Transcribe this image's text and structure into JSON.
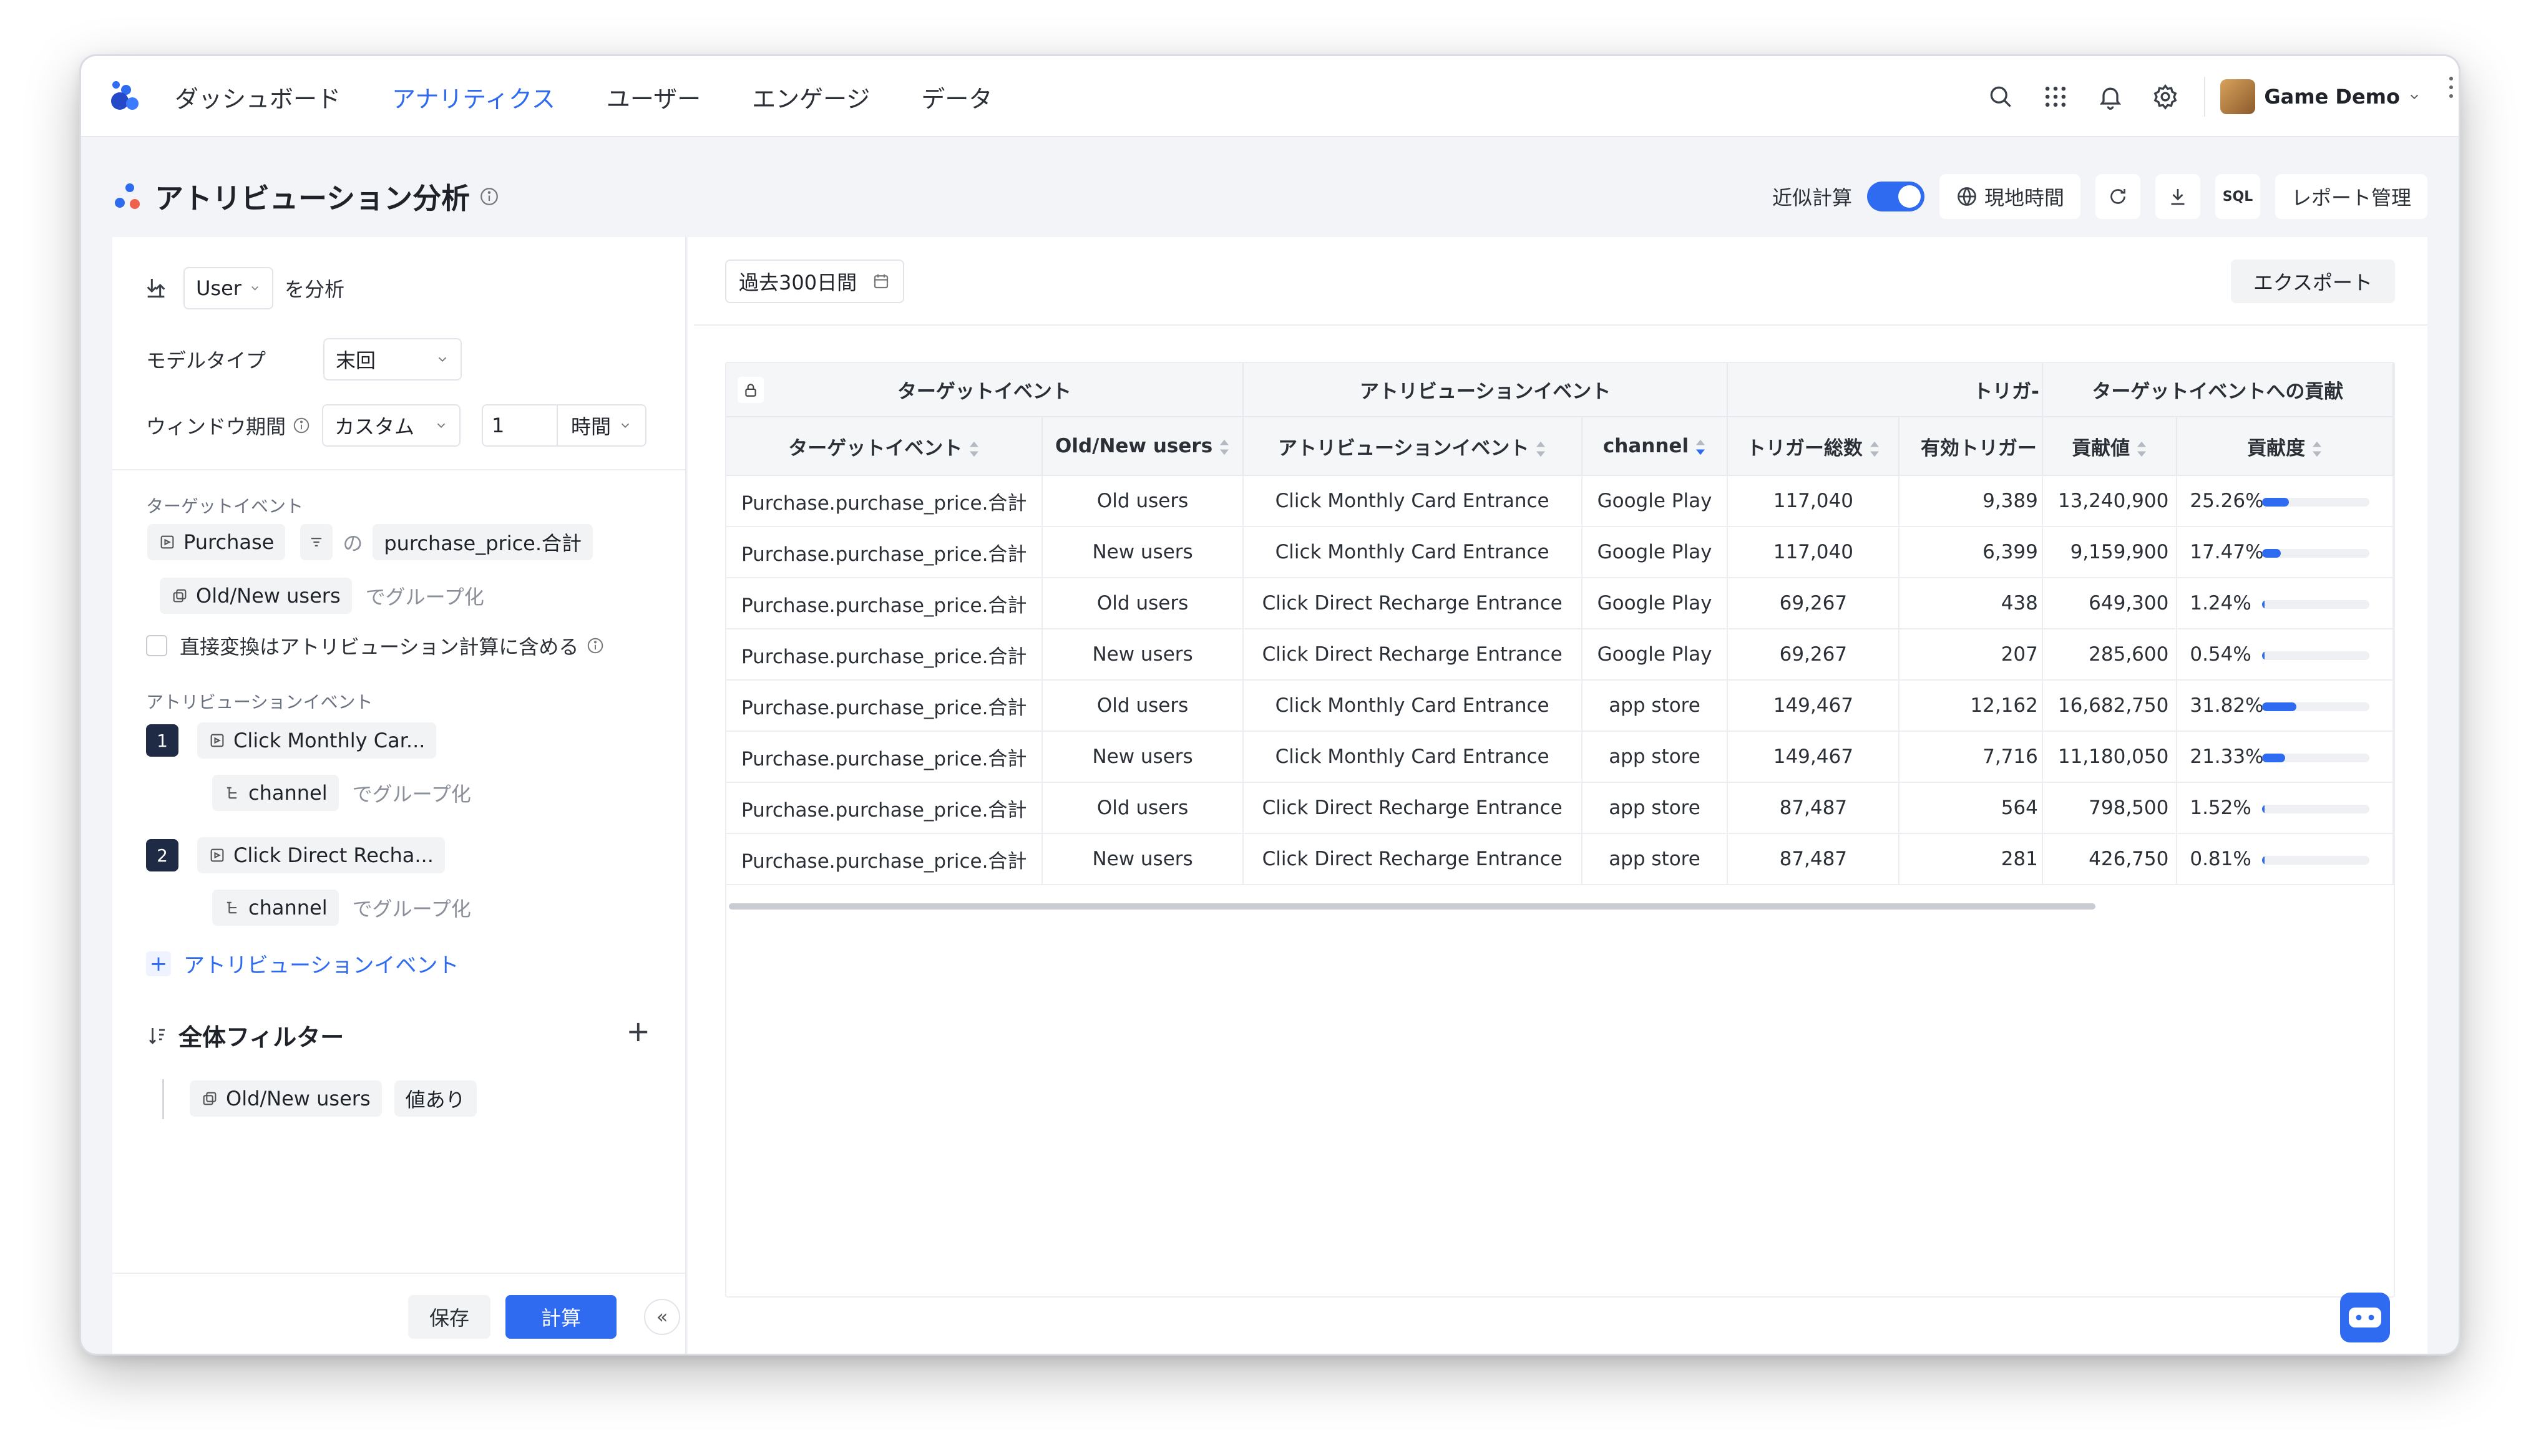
{
  "nav": {
    "items": [
      "ダッシュボード",
      "アナリティクス",
      "ユーザー",
      "エンゲージ",
      "データ"
    ],
    "active_index": 1,
    "user_name": "Game Demo"
  },
  "header": {
    "title": "アトリビューション分析",
    "approx_label": "近似計算",
    "approx_enabled": true,
    "timezone_label": "現地時間",
    "sql_label": "SQL",
    "report_label": "レポート管理"
  },
  "left": {
    "subject_value": "User",
    "subject_suffix": "を分析",
    "model_type_label": "モデルタイプ",
    "model_type_value": "末回",
    "window_label": "ウィンドウ期間",
    "window_mode": "カスタム",
    "window_number": "1",
    "window_unit": "時間",
    "target_section": "ターゲットイベント",
    "target_event": "Purchase",
    "target_of": "の",
    "target_metric": "purchase_price.合計",
    "target_group": "Old/New users",
    "group_suffix": "でグループ化",
    "direct_conversion_label": "直接変換はアトリビューション計算に含める",
    "attribution_section": "アトリビューションイベント",
    "attribution_events": [
      {
        "index": "1",
        "event": "Click Monthly Car...",
        "group": "channel"
      },
      {
        "index": "2",
        "event": "Click Direct Recha...",
        "group": "channel"
      }
    ],
    "add_attribution_label": "アトリビューションイベント",
    "filter_title": "全体フィルター",
    "filter_property": "Old/New users",
    "filter_condition": "値あり",
    "save_label": "保存",
    "calc_label": "計算"
  },
  "right": {
    "date_range": "過去300日間",
    "export_label": "エクスポート"
  },
  "table": {
    "group_headers": {
      "target": "ターゲットイベント",
      "attribution": "アトリビューションイベント",
      "trigger": "トリガ-",
      "contribution": "ターゲットイベントへの貢献"
    },
    "columns": [
      "ターゲットイベント",
      "Old/New users",
      "アトリビューションイベント",
      "channel",
      "トリガー総数",
      "有効トリガー",
      "貢献値",
      "貢献度"
    ],
    "rows": [
      {
        "target": "Purchase.purchase_price.合計",
        "users": "Old users",
        "event": "Click Monthly Card Entrance",
        "channel": "Google Play",
        "total": "117,040",
        "valid": "9,389",
        "value": "13,240,900",
        "pct": "25.26%",
        "ratio": 0.2526
      },
      {
        "target": "Purchase.purchase_price.合計",
        "users": "New users",
        "event": "Click Monthly Card Entrance",
        "channel": "Google Play",
        "total": "117,040",
        "valid": "6,399",
        "value": "9,159,900",
        "pct": "17.47%",
        "ratio": 0.1747
      },
      {
        "target": "Purchase.purchase_price.合計",
        "users": "Old users",
        "event": "Click Direct Recharge Entrance",
        "channel": "Google Play",
        "total": "69,267",
        "valid": "438",
        "value": "649,300",
        "pct": "1.24%",
        "ratio": 0.0124
      },
      {
        "target": "Purchase.purchase_price.合計",
        "users": "New users",
        "event": "Click Direct Recharge Entrance",
        "channel": "Google Play",
        "total": "69,267",
        "valid": "207",
        "value": "285,600",
        "pct": "0.54%",
        "ratio": 0.0054
      },
      {
        "target": "Purchase.purchase_price.合計",
        "users": "Old users",
        "event": "Click Monthly Card Entrance",
        "channel": "app store",
        "total": "149,467",
        "valid": "12,162",
        "value": "16,682,750",
        "pct": "31.82%",
        "ratio": 0.3182
      },
      {
        "target": "Purchase.purchase_price.合計",
        "users": "New users",
        "event": "Click Monthly Card Entrance",
        "channel": "app store",
        "total": "149,467",
        "valid": "7,716",
        "value": "11,180,050",
        "pct": "21.33%",
        "ratio": 0.2133
      },
      {
        "target": "Purchase.purchase_price.合計",
        "users": "Old users",
        "event": "Click Direct Recharge Entrance",
        "channel": "app store",
        "total": "87,487",
        "valid": "564",
        "value": "798,500",
        "pct": "1.52%",
        "ratio": 0.0152
      },
      {
        "target": "Purchase.purchase_price.合計",
        "users": "New users",
        "event": "Click Direct Recharge Entrance",
        "channel": "app store",
        "total": "87,487",
        "valid": "281",
        "value": "426,750",
        "pct": "0.81%",
        "ratio": 0.0081
      }
    ]
  },
  "colors": {
    "accent": "#2f6bf0",
    "page_bg": "#f3f4f7",
    "header_bg": "#f5f6f8"
  }
}
